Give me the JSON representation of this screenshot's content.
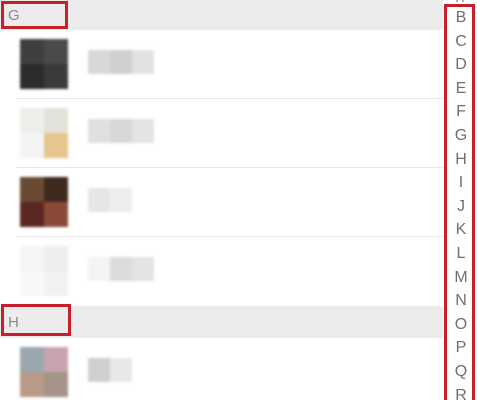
{
  "contact_list": {
    "sections": [
      {
        "letter": "G",
        "rows": [
          {
            "avatar_colors": [
              "#3f3f3f",
              "#4a4a4a",
              "#2c2c2c",
              "#3a3a3a"
            ],
            "name_colors": [
              "#d8d8d8",
              "#cfcfcf",
              "#e2e2e2"
            ]
          },
          {
            "avatar_colors": [
              "#eeeeea",
              "#e2e2da",
              "#f4f4f4",
              "#e6c68c"
            ],
            "name_colors": [
              "#e0e0e0",
              "#d8d8d8",
              "#e4e4e4"
            ]
          },
          {
            "avatar_colors": [
              "#6a4a32",
              "#3f2a1e",
              "#5a2820",
              "#8a4a38"
            ],
            "name_colors": [
              "#e6e6e6",
              "#eeeeee"
            ]
          },
          {
            "avatar_colors": [
              "#f6f6f6",
              "#eeeeee",
              "#f8f8f8",
              "#f2f2f2"
            ],
            "name_colors": [
              "#f4f4f4",
              "#dcdcdc",
              "#e4e4e4"
            ]
          }
        ]
      },
      {
        "letter": "H",
        "rows": [
          {
            "avatar_colors": [
              "#9aa8ae",
              "#c9a2b0",
              "#b99a86",
              "#a4948a"
            ],
            "name_colors": [
              "#cfcfcf",
              "#e8e8e8"
            ]
          }
        ]
      }
    ]
  },
  "index_bar": {
    "top_fragment": "A",
    "letters": [
      "B",
      "C",
      "D",
      "E",
      "F",
      "G",
      "H",
      "I",
      "J",
      "K",
      "L",
      "M",
      "N",
      "O",
      "P",
      "Q",
      "R"
    ]
  },
  "highlight_color": "#c8202b"
}
